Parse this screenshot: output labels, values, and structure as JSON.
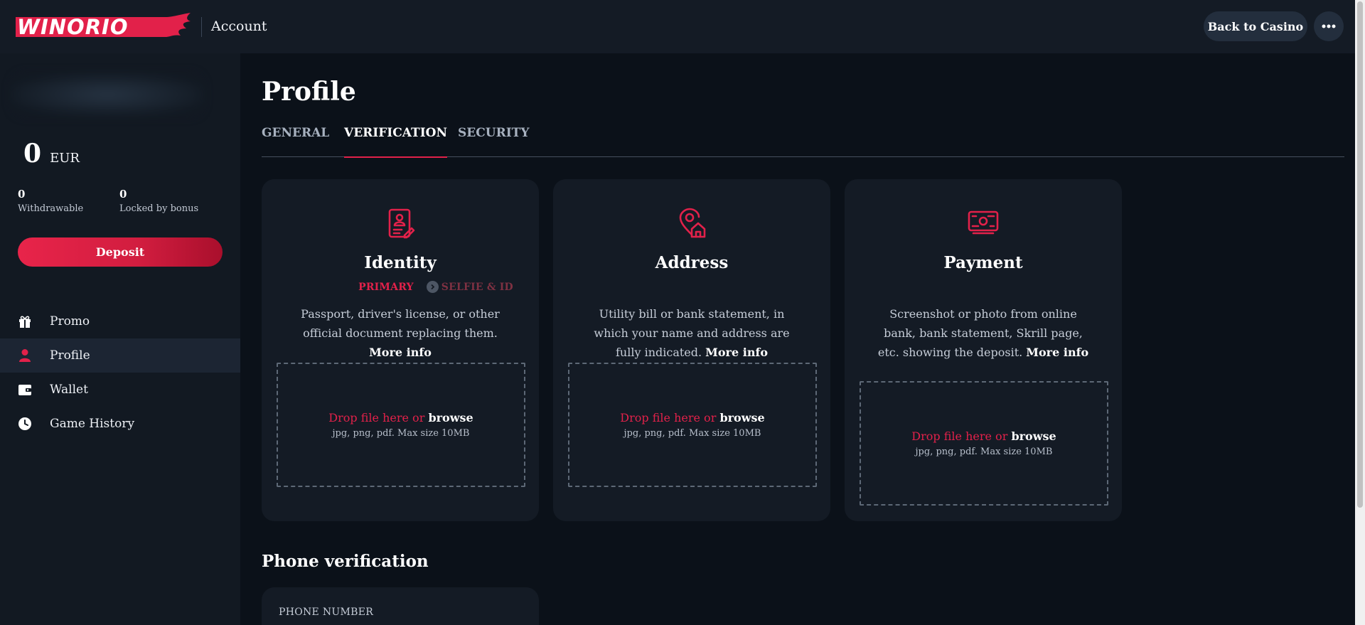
{
  "header": {
    "logo_text": "WINORIO",
    "title": "Account",
    "back_button": "Back to Casino",
    "more_icon": "ellipsis-icon"
  },
  "sidebar": {
    "balance_amount": "0",
    "balance_currency": "EUR",
    "withdrawable_value": "0",
    "withdrawable_label": "Withdrawable",
    "locked_value": "0",
    "locked_label": "Locked by bonus",
    "deposit_label": "Deposit",
    "items": [
      {
        "label": "Promo",
        "icon": "gift-icon",
        "active": false
      },
      {
        "label": "Profile",
        "icon": "user-icon",
        "active": true
      },
      {
        "label": "Wallet",
        "icon": "wallet-icon",
        "active": false
      },
      {
        "label": "Game History",
        "icon": "clock-icon",
        "active": false
      }
    ]
  },
  "main": {
    "page_title": "Profile",
    "tabs": [
      {
        "label": "GENERAL",
        "active": false
      },
      {
        "label": "VERIFICATION",
        "active": true
      },
      {
        "label": "SECURITY",
        "active": false
      }
    ],
    "cards": [
      {
        "title": "Identity",
        "icon": "id-document-icon",
        "step_primary": "PRIMARY",
        "step_secondary": "SELFIE & ID",
        "description": "Passport, driver's license, or other official document replacing them.",
        "more_info": "More info",
        "drop_text": "Drop file here or",
        "browse": "browse",
        "hint": "jpg, png, pdf. Max size 10MB"
      },
      {
        "title": "Address",
        "icon": "location-home-icon",
        "description": "Utility bill or bank statement, in which your name and address are fully indicated.",
        "more_info": "More info",
        "drop_text": "Drop file here or",
        "browse": "browse",
        "hint": "jpg, png, pdf. Max size 10MB"
      },
      {
        "title": "Payment",
        "icon": "payment-screen-icon",
        "description": "Screenshot or photo from online bank, bank statement, Skrill page, etc. showing the deposit.",
        "more_info": "More info",
        "drop_text": "Drop file here or",
        "browse": "browse",
        "hint": "jpg, png, pdf. Max size 10MB"
      }
    ],
    "phone_section_title": "Phone verification",
    "phone_label": "PHONE NUMBER"
  },
  "colors": {
    "accent": "#e2214a",
    "background": "#0b1119",
    "panel": "#141b25"
  }
}
